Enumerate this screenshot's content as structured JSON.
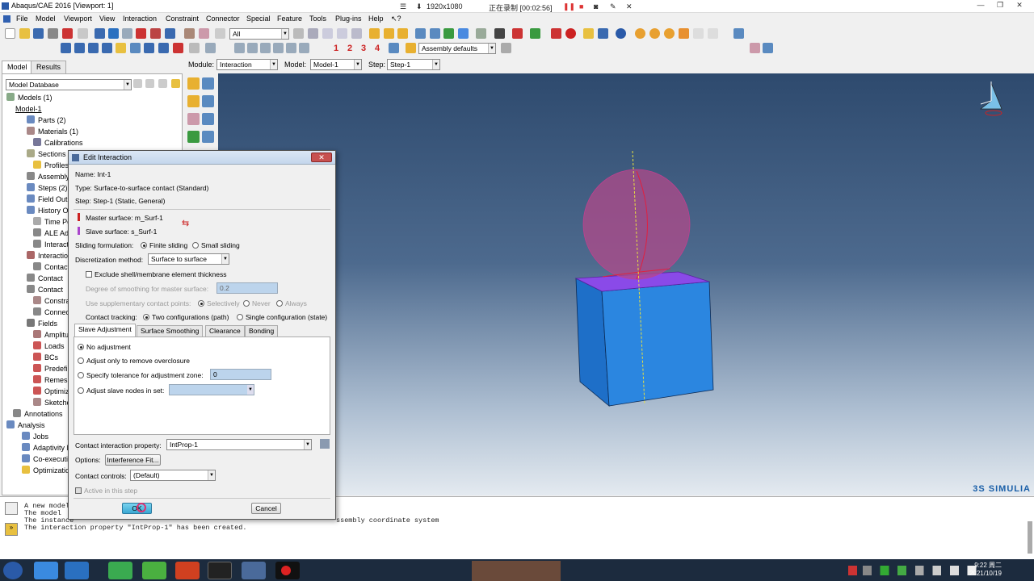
{
  "window": {
    "title": "Abaqus/CAE 2016 [Viewport: 1]"
  },
  "recorder": {
    "resolution": "1920x1080",
    "status": "正在录制 [00:02:56]"
  },
  "menu": [
    "File",
    "Model",
    "Viewport",
    "View",
    "Interaction",
    "Constraint",
    "Connector",
    "Special",
    "Feature",
    "Tools",
    "Plug-ins",
    "Help"
  ],
  "toolbar": {
    "selection_filter": "All",
    "view_numbers": [
      "1",
      "2",
      "3",
      "4"
    ],
    "assembly_display": "Assembly defaults"
  },
  "context": {
    "module_label": "Module:",
    "module": "Interaction",
    "model_label": "Model:",
    "model": "Model-1",
    "step_label": "Step:",
    "step": "Step-1"
  },
  "left_tabs": [
    "Model",
    "Results"
  ],
  "tree": {
    "db": "Model Database",
    "items": [
      "Models (1)",
      "Model-1",
      "Parts (2)",
      "Materials (1)",
      "Calibrations",
      "Sections",
      "Profiles",
      "Assembly",
      "Steps (2)",
      "Field Output",
      "History Output",
      "Time Points",
      "ALE Adaptive",
      "Interaction",
      "Interactions",
      "Contact",
      "Contact",
      "Contact",
      "Constraints",
      "Connector",
      "Fields",
      "Amplitudes",
      "Loads",
      "BCs",
      "Predefined",
      "Remeshing",
      "Optimization",
      "Sketches",
      "Annotations",
      "Analysis",
      "Jobs",
      "Adaptivity Processes",
      "Co-executions",
      "Optimization"
    ]
  },
  "dialog": {
    "title": "Edit Interaction",
    "name": "Name:  Int-1",
    "type": "Type:   Surface-to-surface contact (Standard)",
    "step": "Step:   Step-1 (Static, General)",
    "master": "Master surface:  m_Surf-1",
    "slave": "Slave surface:     s_Surf-1",
    "sliding_label": "Sliding formulation:",
    "sliding_opts": [
      "Finite sliding",
      "Small sliding"
    ],
    "disc_label": "Discretization method:",
    "disc_value": "Surface to surface",
    "exclude": "Exclude shell/membrane element thickness",
    "smooth_label": "Degree of smoothing for master surface:",
    "smooth_value": "0.2",
    "supp_label": "Use supplementary contact points:",
    "supp_opts": [
      "Selectively",
      "Never",
      "Always"
    ],
    "tracking_label": "Contact tracking:",
    "tracking_opts": [
      "Two configurations (path)",
      "Single configuration (state)"
    ],
    "tabs": [
      "Slave Adjustment",
      "Surface Smoothing",
      "Clearance",
      "Bonding"
    ],
    "adjust_opts": [
      "No adjustment",
      "Adjust only to remove overclosure",
      "Specify tolerance for adjustment zone:",
      "Adjust slave nodes in set:"
    ],
    "tolerance": "0",
    "property_label": "Contact interaction property:",
    "property": "IntProp-1",
    "options_label": "Options:",
    "interference_btn": "Interference Fit...",
    "controls_label": "Contact controls:",
    "controls": "(Default)",
    "active": "Active in this step",
    "ok": "OK",
    "cancel": "Cancel"
  },
  "messages": [
    "A new model",
    "The model",
    "The instance",
    "The interaction property \"IntProp-1\" has been created."
  ],
  "message_tail": "ssembly coordinate system",
  "brand": "3S SIMULIA",
  "clock": {
    "time": "9:22 周二",
    "date": "2021/10/19"
  }
}
